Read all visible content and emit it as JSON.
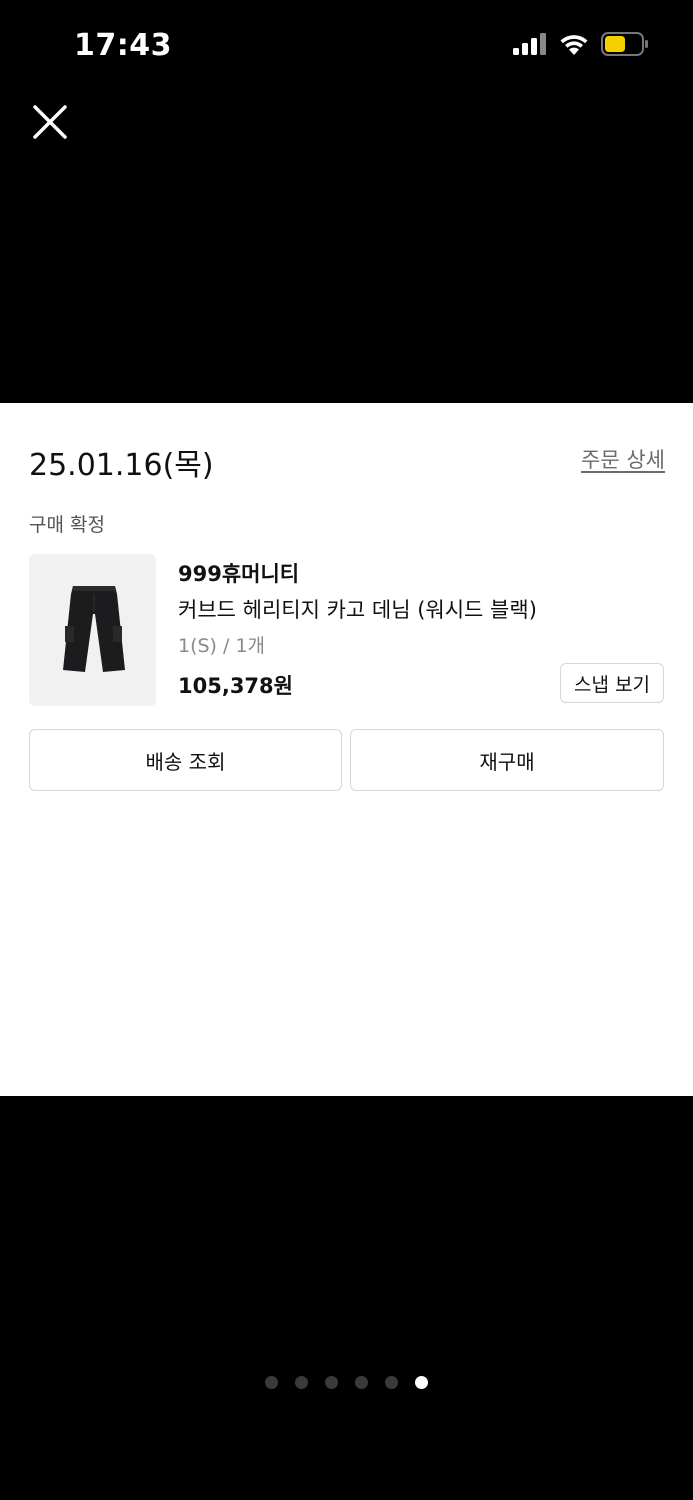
{
  "status_bar": {
    "time": "17:43"
  },
  "order": {
    "date": "25.01.16(목)",
    "detail_link": "주문 상세",
    "status": "구매 확정"
  },
  "product": {
    "brand": "999휴머니티",
    "name": "커브드 헤리티지 카고 데님 (워시드 블랙)",
    "option": "1(S) / 1개",
    "price": "105,378원",
    "snap_label": "스냅 보기"
  },
  "actions": {
    "tracking_label": "배송 조회",
    "reorder_label": "재구매"
  },
  "pager": {
    "total": 6,
    "active_index": 5
  },
  "colors": {
    "battery": "#f5d000",
    "background": "#000000",
    "card": "#ffffff"
  }
}
